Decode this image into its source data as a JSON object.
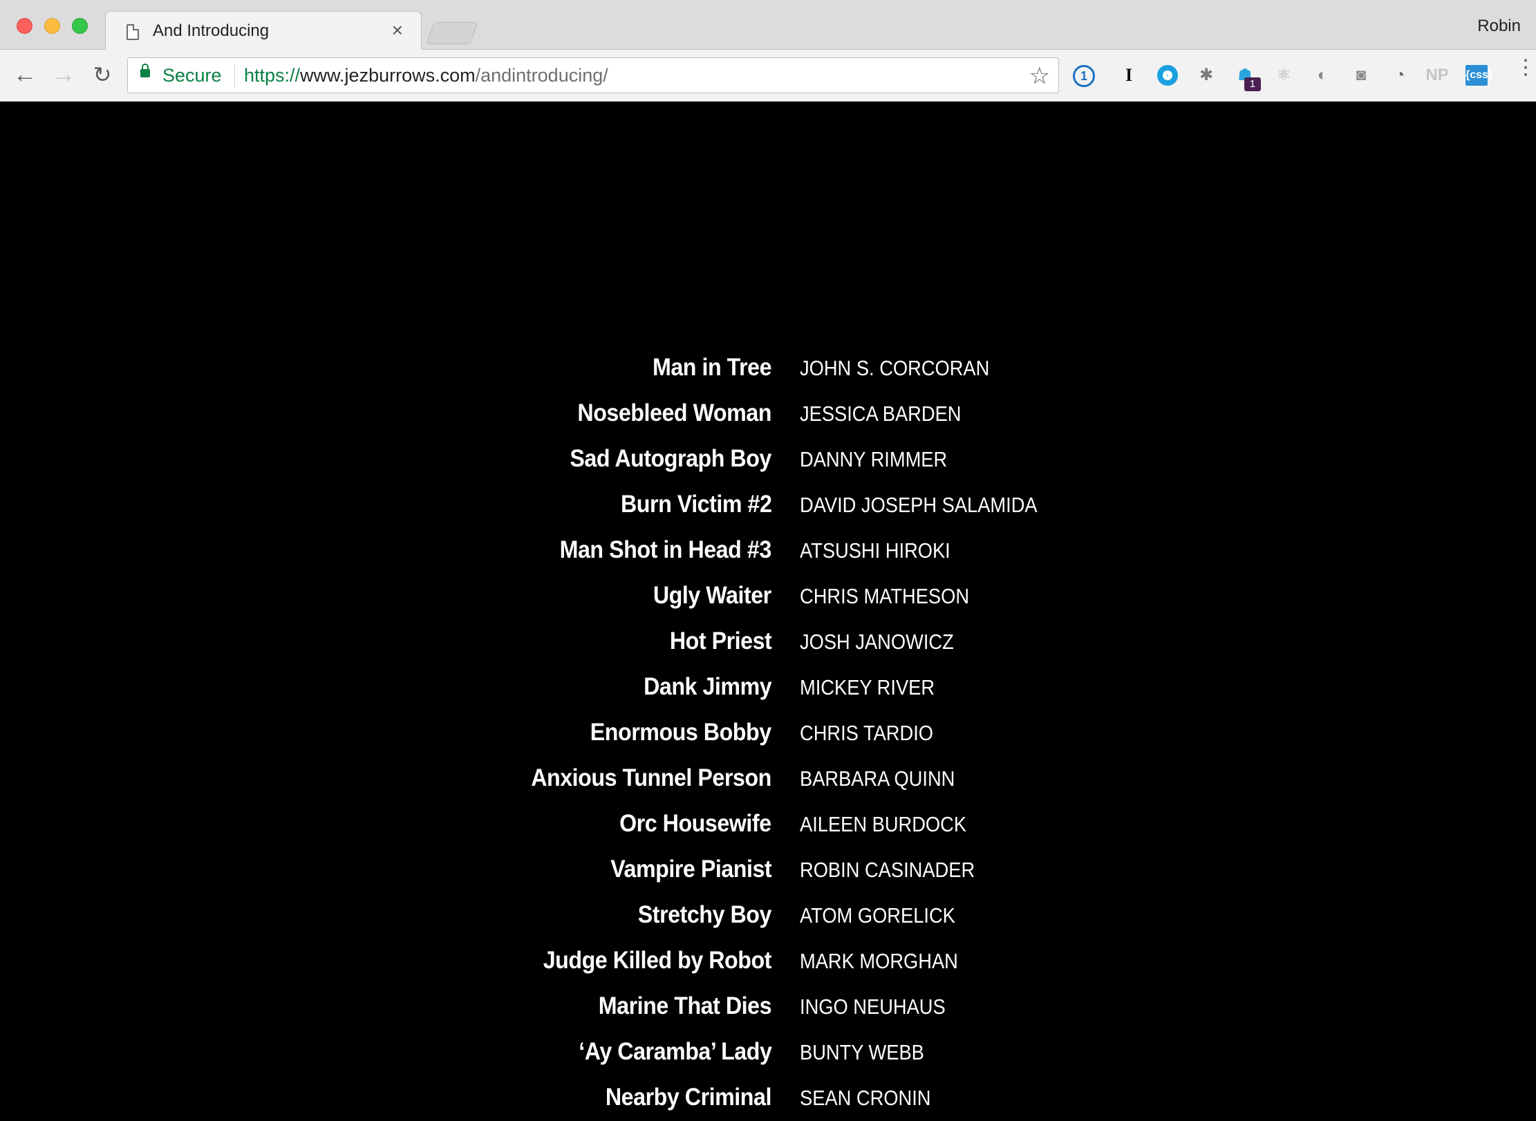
{
  "browser": {
    "tab": {
      "title": "And Introducing",
      "close": "×"
    },
    "profile": "Robin",
    "nav": {
      "back": "←",
      "forward": "→",
      "reload": "↻"
    },
    "omnibox": {
      "secure_label": "Secure",
      "url_scheme": "https://",
      "url_host": "www.jezburrows.com",
      "url_path": "/andintroducing/",
      "star": "☆"
    },
    "extensions": {
      "onepassword": "1",
      "instapaper": "I",
      "bug": "✱",
      "ghost": "☗",
      "ghost_badge": "1",
      "react": "⚛",
      "moon": "◐",
      "camera": "◙",
      "gauge": "◔",
      "np": "NP",
      "css": "{css}"
    },
    "menu": "⋮"
  },
  "credits": [
    {
      "role": "Man in Tree",
      "actor": "JOHN S. CORCORAN"
    },
    {
      "role": "Nosebleed Woman",
      "actor": "JESSICA BARDEN"
    },
    {
      "role": "Sad Autograph Boy",
      "actor": "DANNY RIMMER"
    },
    {
      "role": "Burn Victim #2",
      "actor": "DAVID JOSEPH SALAMIDA"
    },
    {
      "role": "Man Shot in Head #3",
      "actor": "ATSUSHI HIROKI"
    },
    {
      "role": "Ugly Waiter",
      "actor": "CHRIS MATHESON"
    },
    {
      "role": "Hot Priest",
      "actor": "JOSH JANOWICZ"
    },
    {
      "role": "Dank Jimmy",
      "actor": "MICKEY RIVER"
    },
    {
      "role": "Enormous Bobby",
      "actor": "CHRIS TARDIO"
    },
    {
      "role": "Anxious Tunnel Person",
      "actor": "BARBARA QUINN"
    },
    {
      "role": "Orc Housewife",
      "actor": "AILEEN BURDOCK"
    },
    {
      "role": "Vampire Pianist",
      "actor": "ROBIN CASINADER"
    },
    {
      "role": "Stretchy Boy",
      "actor": "ATOM GORELICK"
    },
    {
      "role": "Judge Killed by Robot",
      "actor": "MARK MORGHAN"
    },
    {
      "role": "Marine That Dies",
      "actor": "INGO NEUHAUS"
    },
    {
      "role": "‘Ay Caramba’ Lady",
      "actor": "BUNTY WEBB"
    },
    {
      "role": "Nearby Criminal",
      "actor": "SEAN CRONIN"
    }
  ]
}
